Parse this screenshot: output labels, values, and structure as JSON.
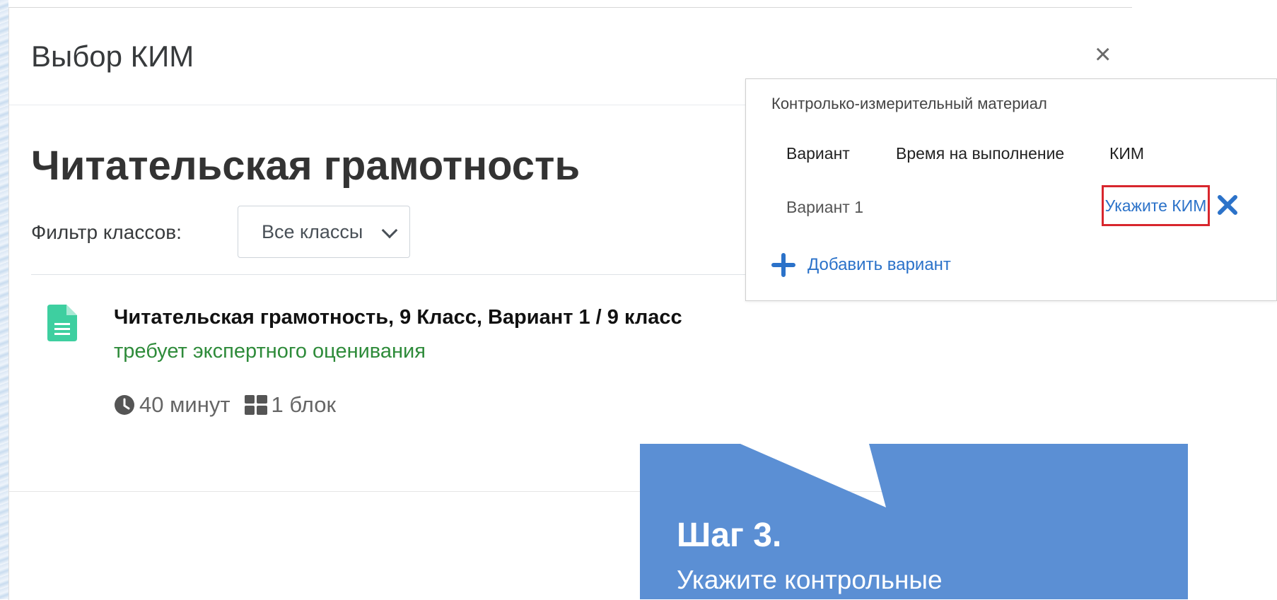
{
  "modal": {
    "title": "Выбор КИМ",
    "close_symbol": "×"
  },
  "course": {
    "title": "Читательская грамотность"
  },
  "filter": {
    "label": "Фильтр классов:",
    "selected": "Все классы"
  },
  "test_item": {
    "title": "Читательская грамотность, 9 Класс, Вариант 1 / 9 класс",
    "status": "требует экспертного оценивания",
    "duration": "40 минут",
    "blocks": "1 блок",
    "icon": "document-icon"
  },
  "popup": {
    "header": "Контролько-измерительный материал",
    "columns": [
      "Вариант",
      "Время на выполнение",
      "КИМ"
    ],
    "row": {
      "variant": "Вариант 1",
      "kim_link": "Укажите КИМ"
    },
    "add_variant": "Добавить вариант"
  },
  "callout": {
    "step": "Шаг 3.",
    "text": "Укажите контрольные"
  },
  "colors": {
    "accent_blue": "#2b72c9",
    "status_green": "#2e8b3a",
    "callout_blue": "#5b8fd4",
    "highlight_red": "#d8262d",
    "doc_icon_teal": "#3ecfa0"
  }
}
